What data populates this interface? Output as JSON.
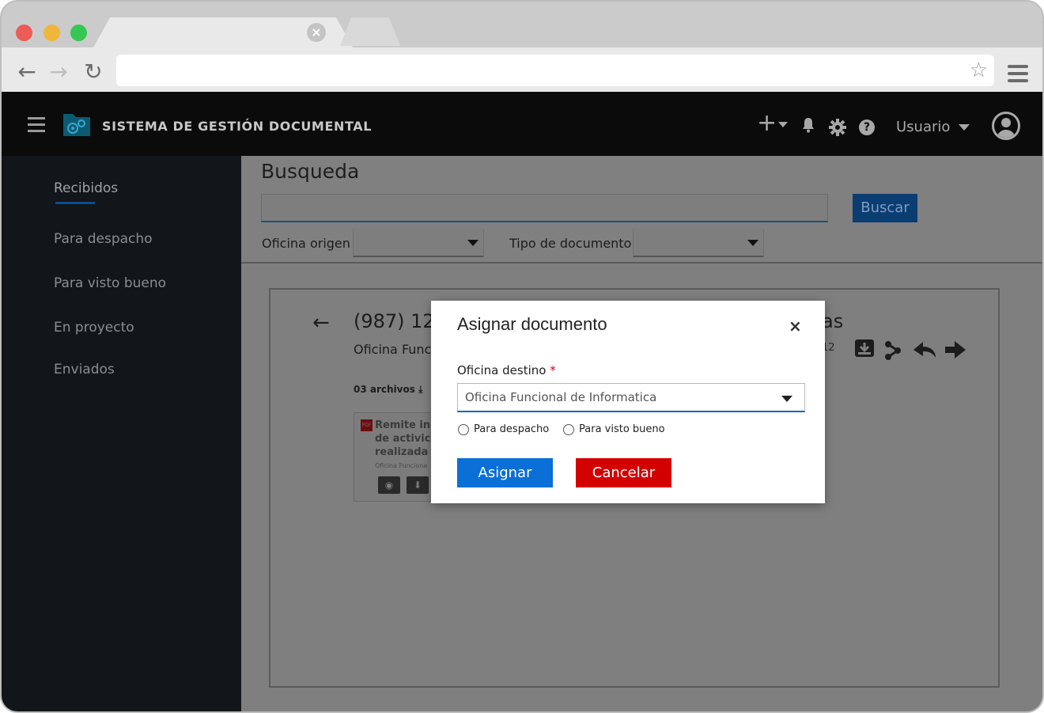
{
  "browser": {
    "url": "",
    "icons": [
      "back-icon",
      "forward-icon",
      "reload-icon",
      "star-icon",
      "menu-icon",
      "close-icon"
    ]
  },
  "header": {
    "app_title": "SISTEMA DE GESTIÓN DOCUMENTAL",
    "user_label": "Usuario",
    "colors": {
      "background": "#0b0b0b",
      "text": "#c8c8c8"
    }
  },
  "sidebar": {
    "items": [
      {
        "label": "Recibidos",
        "active": true
      },
      {
        "label": "Para despacho"
      },
      {
        "label": "Para visto bueno"
      },
      {
        "label": "En proyecto"
      },
      {
        "label": "Enviados"
      }
    ]
  },
  "search": {
    "title": "Busqueda",
    "input_value": "",
    "button_label": "Buscar",
    "filters": [
      {
        "label": "Oficina origen",
        "value": ""
      },
      {
        "label": "Tipo de documento",
        "value": ""
      }
    ]
  },
  "document": {
    "title_visible": "(987) 12",
    "title_tail_visible": "as",
    "office_visible": "Oficina Func",
    "date_visible": "12",
    "files_label": "03 archivos",
    "file": {
      "name_visible": "Remite in\nde activic\nrealizada",
      "office_visible": "Oficina Funciona",
      "type": "PDF"
    }
  },
  "modal": {
    "title": "Asignar documento",
    "close_symbol": "×",
    "field_label": "Oficina destino",
    "required_mark": "*",
    "selected_value": "Oficina Funcional de Informatica",
    "radio_options": [
      "Para despacho",
      "Para visto bueno"
    ],
    "primary_label": "Asignar",
    "cancel_label": "Cancelar",
    "colors": {
      "primary": "#0a6fd6",
      "danger": "#d30000",
      "required": "#d0021b"
    }
  }
}
